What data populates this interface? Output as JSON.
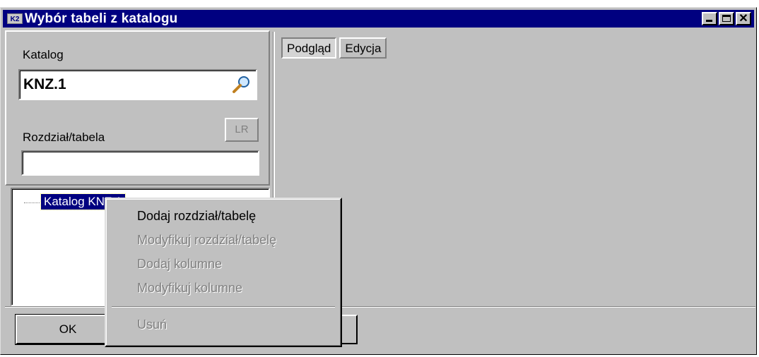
{
  "window": {
    "icon_text": "K2",
    "title": "Wybór tabeli z katalogu",
    "minimize": "minimize",
    "maximize": "maximize",
    "close": "✕"
  },
  "left": {
    "catalog_label": "Katalog",
    "catalog_value": "KNZ.1",
    "section_label": "Rozdział/tabela",
    "section_value": "",
    "lr_button": "LR"
  },
  "tree": {
    "root": "Katalog KNZ.1"
  },
  "tabs": [
    {
      "label": "Podgląd",
      "active": true
    },
    {
      "label": "Edycja",
      "active": false
    }
  ],
  "buttons": {
    "ok": "OK",
    "cancel": "",
    "help": ""
  },
  "context_menu": {
    "items": [
      {
        "label": "Dodaj rozdział/tabelę",
        "enabled": true
      },
      {
        "label": "Modyfikuj rozdział/tabelę",
        "enabled": false
      },
      {
        "label": "Dodaj kolumne",
        "enabled": false
      },
      {
        "label": "Modyfikuj kolumne",
        "enabled": false
      },
      {
        "label": "Usuń",
        "enabled": false
      }
    ]
  },
  "colors": {
    "titlebar": "#000080",
    "face": "#c0c0c0",
    "selection": "#000080"
  }
}
